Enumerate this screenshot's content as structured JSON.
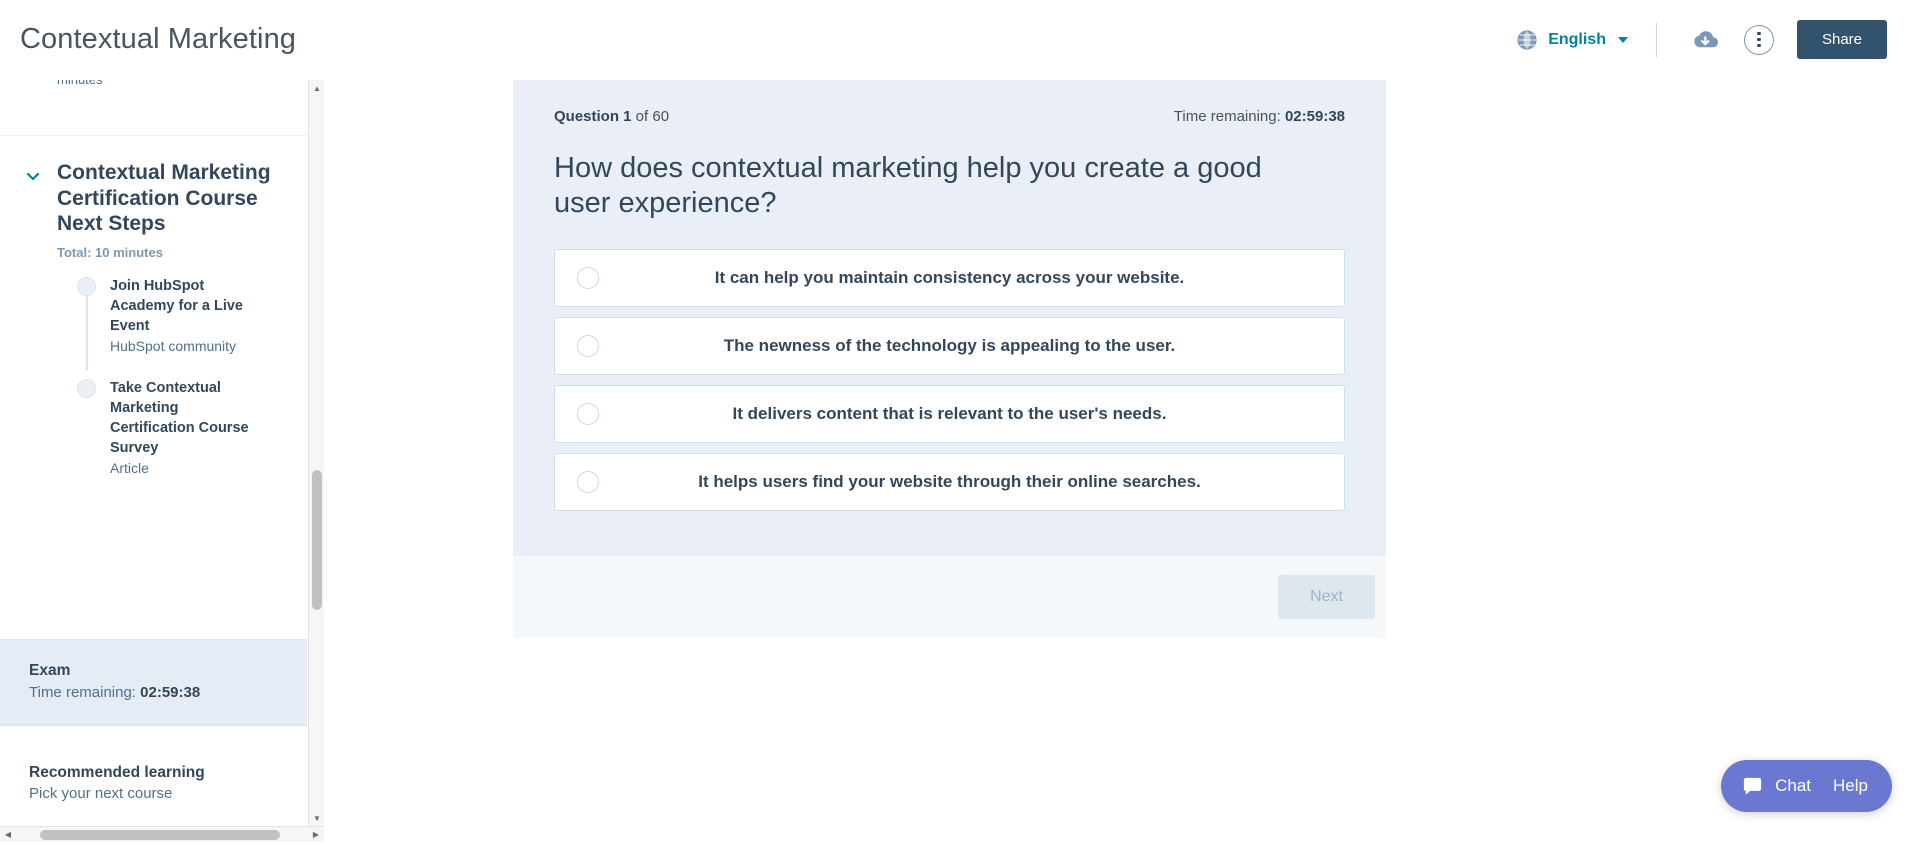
{
  "header": {
    "title": "Contextual Marketing",
    "language": {
      "globe_icon": "globe-icon",
      "label": "English",
      "caret_icon": "chevron-down-icon"
    },
    "download_icon": "cloud-download-icon",
    "more_icon": "kebab-menu-icon",
    "share_label": "Share"
  },
  "sidebar": {
    "partial_text": "minutes",
    "section": {
      "chevron_icon": "chevron-down-icon",
      "title": "Contextual Marketing Certification Course Next Steps",
      "total": "Total: 10 minutes",
      "items": [
        {
          "title": "Join HubSpot Academy for a Live Event",
          "subtitle": "HubSpot community"
        },
        {
          "title": "Take Contextual Marketing Certification Course Survey",
          "subtitle": "Article"
        }
      ]
    },
    "exam": {
      "title": "Exam",
      "time_label": "Time remaining:",
      "time_value": "02:59:38"
    },
    "recommended": {
      "title": "Recommended learning",
      "subtitle": "Pick your next course"
    }
  },
  "quiz": {
    "question_prefix": "Question 1",
    "question_suffix": " of 60",
    "timer_label": "Time remaining: ",
    "timer_value": "02:59:38",
    "question": "How does contextual marketing help you create a good user experience?",
    "options": [
      {
        "text": "It can help you maintain consistency across your website.",
        "selected": false
      },
      {
        "text": "The newness of the technology is appealing to the user.",
        "selected": false
      },
      {
        "text": "It delivers content that is relevant to the user's needs.",
        "selected": false
      },
      {
        "text": "It helps users find your website through their online searches.",
        "selected": false
      }
    ],
    "next_label": "Next"
  },
  "chat": {
    "icon": "chat-bubble-icon",
    "chat_label": "Chat",
    "help_label": "Help"
  },
  "colors": {
    "accent_teal": "#00849e",
    "share_button": "#33526b",
    "quiz_background": "#e9eef7",
    "option_border": "#c8e2ea",
    "chat_widget": "#6a78d1",
    "text_primary": "#33475b",
    "text_secondary": "#516f90"
  }
}
